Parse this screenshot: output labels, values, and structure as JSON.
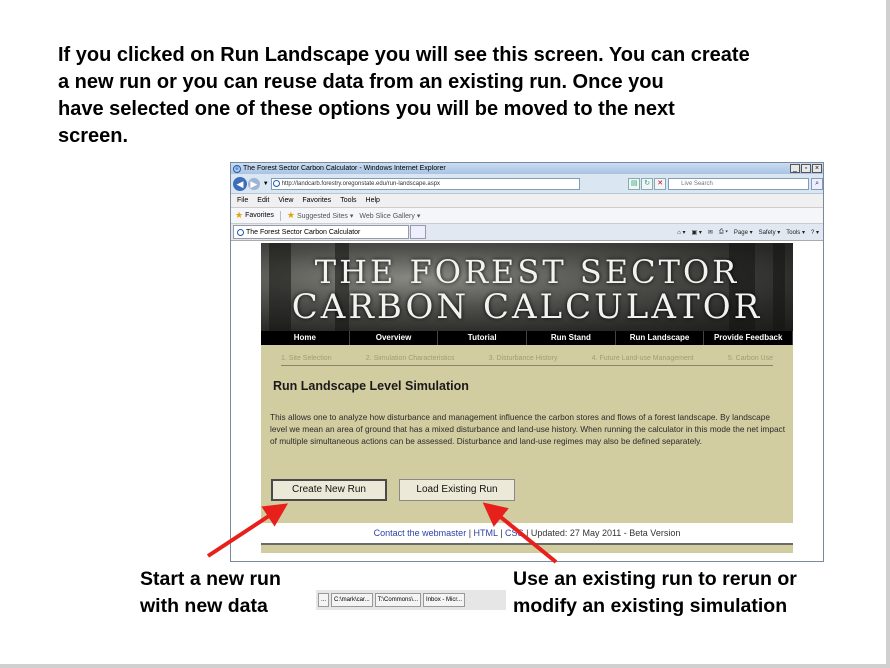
{
  "intro_text": {
    "line1": "If you clicked on Run Landscape you will see this screen. You can create",
    "line2": "a new run or you can reuse data from an existing run.  Once you",
    "line3": "have selected one of these options you will be moved to the next",
    "line4": "screen."
  },
  "browser": {
    "window_title": "The Forest Sector Carbon Calculator - Windows Internet Explorer",
    "url": "http://landcarb.forestry.oregonstate.edu/run-landscape.aspx",
    "search_placeholder": "Live Search",
    "menu": [
      "File",
      "Edit",
      "View",
      "Favorites",
      "Tools",
      "Help"
    ],
    "favorites_label": "Favorites",
    "suggested_sites": "Suggested Sites ▾",
    "web_slice_gallery": "Web Slice Gallery ▾",
    "tab_title": "The Forest Sector Carbon Calculator",
    "command_bar": [
      "Page ▾",
      "Safety ▾",
      "Tools ▾"
    ]
  },
  "site": {
    "banner_line1": "THE FOREST SECTOR",
    "banner_line2": "CARBON CALCULATOR",
    "nav": [
      "Home",
      "Overview",
      "Tutorial",
      "Run Stand",
      "Run Landscape",
      "Provide Feedback"
    ],
    "steps": [
      "1. Site Selection",
      "2. Simulation Characteristics",
      "3. Disturbance History",
      "4. Future Land-use Management",
      "5. Carbon Use"
    ],
    "heading": "Run Landscape Level Simulation",
    "description": "This allows one to analyze how disturbance and management influence the carbon stores and flows of a forest landscape. By landscape level we mean an area of ground that has a mixed disturbance and land-use history. When running the calculator in this mode the net impact of multiple simultaneous actions can be assessed. Disturbance and land-use regimes may also be defined separately.",
    "create_button": "Create New Run",
    "load_button": "Load Existing Run",
    "footer": {
      "contact": "Contact the webmaster",
      "sep1": " | ",
      "html": "HTML",
      "sep2": " | ",
      "css": "CSS",
      "updated": " | Updated: 27 May 2011 - Beta Version"
    }
  },
  "taskbar": {
    "items": [
      "...",
      "C:\\mark\\car...",
      "T:\\Commons\\...",
      "Inbox - Micr..."
    ]
  },
  "callouts": {
    "left_line1": "Start a new run",
    "left_line2": "with new data",
    "right_line1": "Use an existing run to rerun or",
    "right_line2": "modify an existing simulation"
  },
  "colors": {
    "arrow": "#e8201c",
    "site_background": "#d2cca1",
    "nav_background": "#000000",
    "link": "#2c3ea8"
  }
}
